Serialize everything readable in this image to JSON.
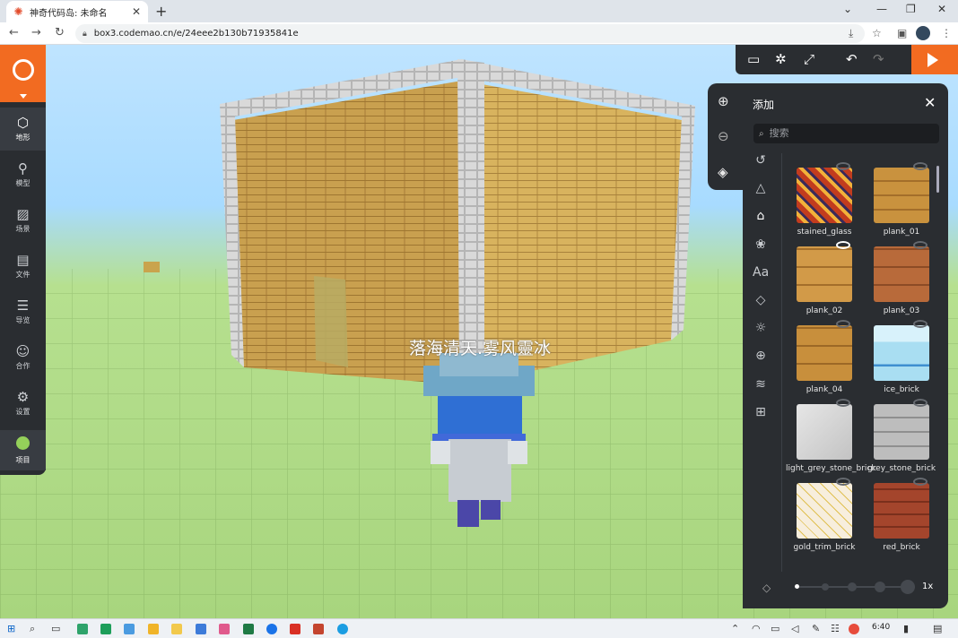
{
  "browser": {
    "tab_title": "神奇代码岛: 未命名",
    "url": "box3.codemao.cn/e/24eee2b130b71935841e",
    "new_tab": "+",
    "tab_close": "✕"
  },
  "sidebar": {
    "items": [
      {
        "label": "地形",
        "icon": "cube-icon"
      },
      {
        "label": "模型",
        "icon": "tree-icon"
      },
      {
        "label": "场景",
        "icon": "image-icon"
      },
      {
        "label": "文件",
        "icon": "folder-icon"
      },
      {
        "label": "导览",
        "icon": "list-icon"
      },
      {
        "label": "合作",
        "icon": "people-icon"
      },
      {
        "label": "设置",
        "icon": "gear-icon"
      },
      {
        "label": "项目",
        "icon": "project-icon"
      }
    ]
  },
  "scene": {
    "player_name": "落海清天.雾风靈冰"
  },
  "panel": {
    "title": "添加",
    "search_placeholder": "搜索",
    "zoom_label": "1x",
    "items": [
      {
        "name": "stained_glass",
        "color": "#c23c1e",
        "accent": "#f2b13a"
      },
      {
        "name": "plank_01",
        "color": "#c9923e",
        "accent": "#a36e2a"
      },
      {
        "name": "plank_02",
        "color": "#d29a48",
        "accent": "#a36e2a"
      },
      {
        "name": "plank_03",
        "color": "#b86a3a",
        "accent": "#8c4b25"
      },
      {
        "name": "plank_04",
        "color": "#c88f3c",
        "accent": "#9c6826"
      },
      {
        "name": "ice_brick",
        "color": "#a9def2",
        "accent": "#3f8fd0"
      },
      {
        "name": "light_grey_stone_brick",
        "color": "#d7d7d7",
        "accent": "#b3b3b3"
      },
      {
        "name": "grey_stone_brick",
        "color": "#bdbdbd",
        "accent": "#8f8f8f"
      },
      {
        "name": "gold_trim_brick",
        "color": "#f7eedd",
        "accent": "#e0c052"
      },
      {
        "name": "red_brick",
        "color": "#a4452c",
        "accent": "#7a2f1c"
      }
    ]
  },
  "taskbar": {
    "time": "6:40"
  }
}
